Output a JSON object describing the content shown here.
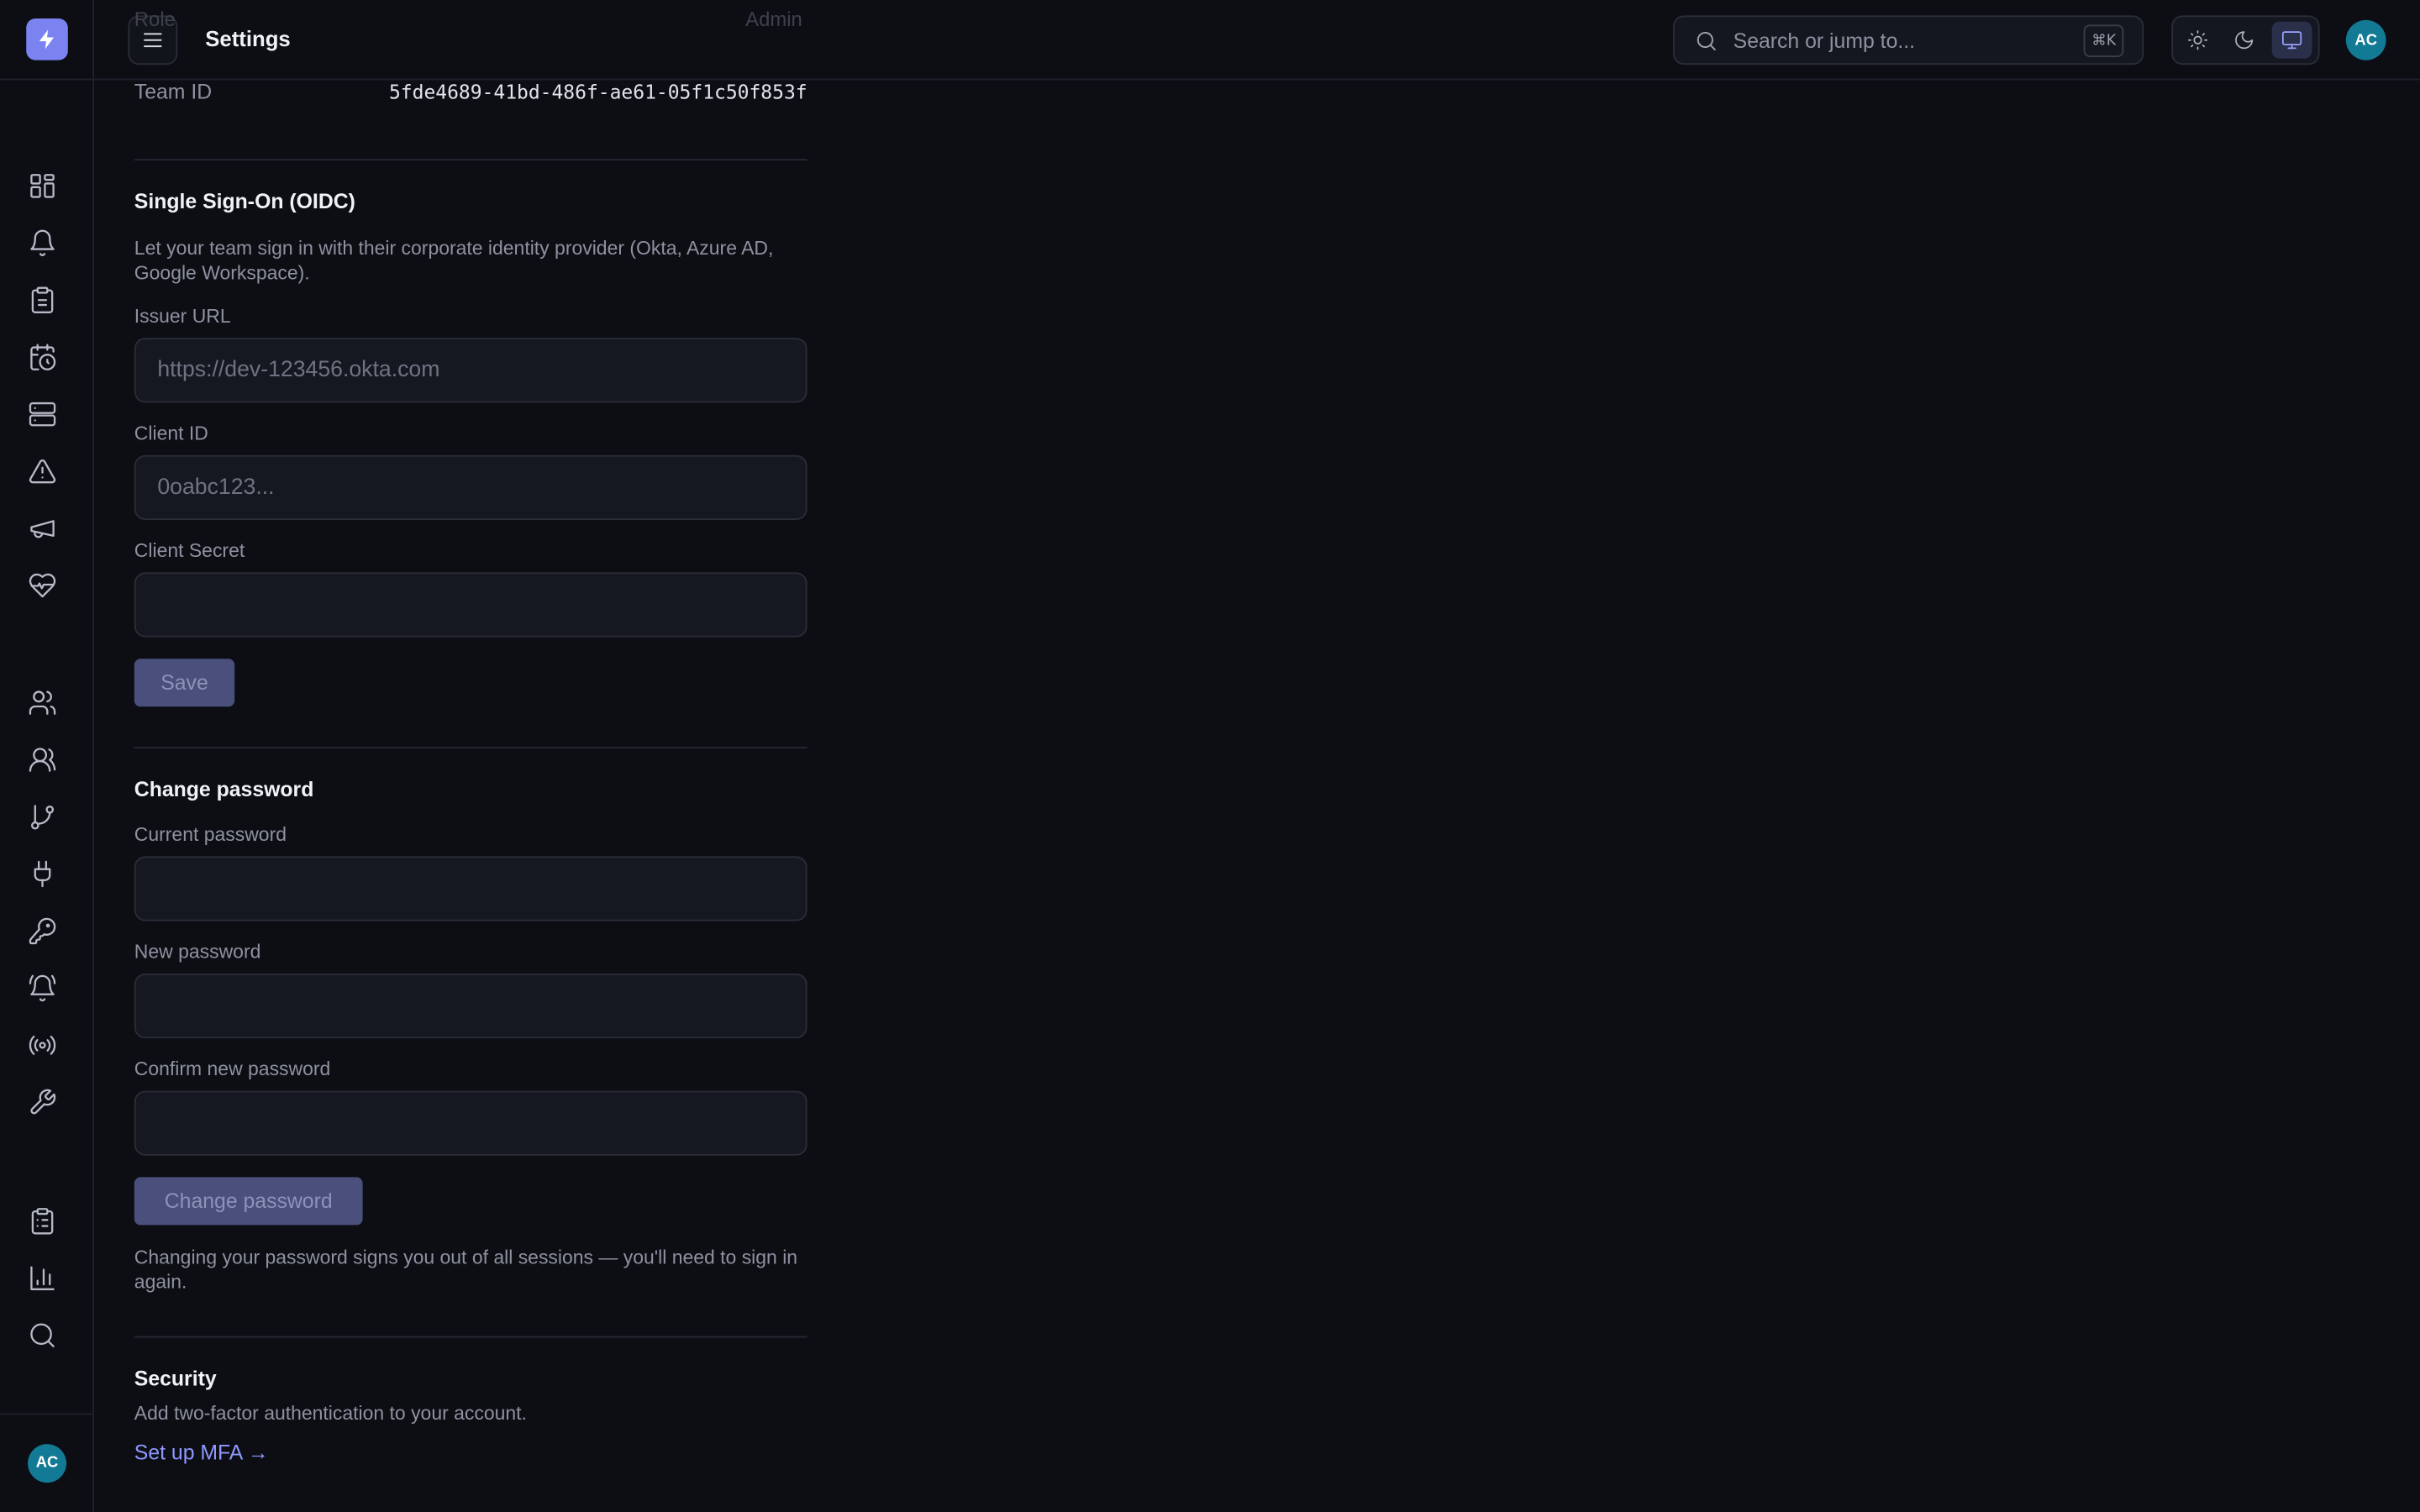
{
  "app": {
    "page_title": "Settings",
    "ghost_left": "Role",
    "ghost_right": "Admin"
  },
  "search": {
    "placeholder": "Search or jump to...",
    "shortcut": "⌘K"
  },
  "theme": {
    "options": [
      "light",
      "dark",
      "system"
    ],
    "selected": "system"
  },
  "user": {
    "initials": "AC"
  },
  "sidebar": {
    "primary_items": [
      "dashboard-icon",
      "bell-icon",
      "clipboard-icon",
      "calendar-clock-icon",
      "server-icon",
      "alert-triangle-icon",
      "megaphone-icon",
      "heart-pulse-icon"
    ],
    "secondary_items": [
      "users-icon",
      "team-icon",
      "git-branch-icon",
      "plug-icon",
      "key-icon",
      "bell-ring-icon",
      "broadcast-icon",
      "wrench-icon"
    ],
    "bottom_items": [
      "clipboard-list-icon",
      "bar-chart-icon",
      "search-icon"
    ]
  },
  "team": {
    "id_label": "Team ID",
    "id_value": "5fde4689-41bd-486f-ae61-05f1c50f853f"
  },
  "sso": {
    "heading": "Single Sign-On (OIDC)",
    "description": "Let your team sign in with their corporate identity provider (Okta, Azure AD, Google Workspace).",
    "issuer_label": "Issuer URL",
    "issuer_placeholder": "https://dev-123456.okta.com",
    "client_id_label": "Client ID",
    "client_id_placeholder": "0oabc123...",
    "client_secret_label": "Client Secret",
    "client_secret_placeholder": "",
    "save_label": "Save"
  },
  "password": {
    "heading": "Change password",
    "current_label": "Current password",
    "new_label": "New password",
    "confirm_label": "Confirm new password",
    "button_label": "Change password",
    "note": "Changing your password signs you out of all sessions — you'll need to sign in again."
  },
  "security": {
    "heading": "Security",
    "description": "Add two-factor authentication to your account.",
    "mfa_link": "Set up MFA →"
  },
  "colors": {
    "background": "#0c0e14",
    "accent": "#7b83f0",
    "link": "#8f98ff",
    "avatar": "#137a96"
  }
}
